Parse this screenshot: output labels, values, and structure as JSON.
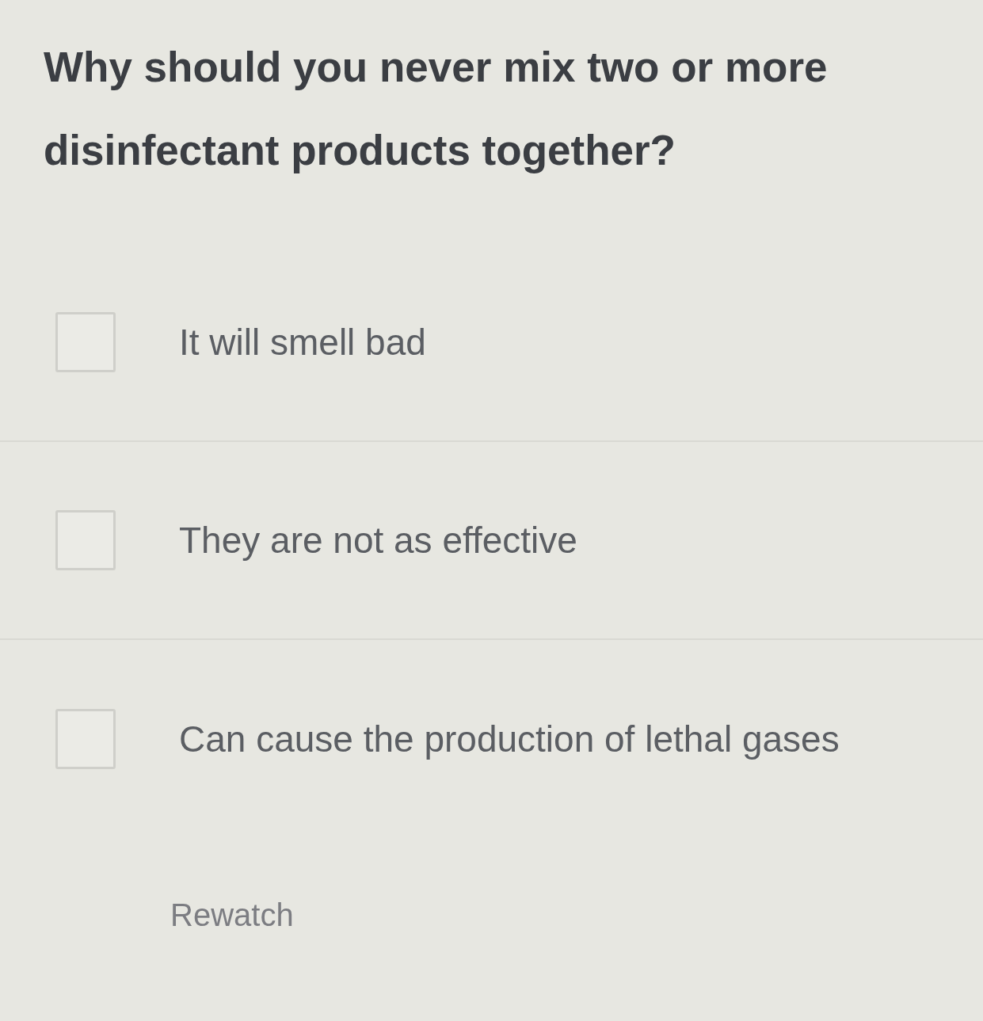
{
  "question": "Why should you never mix two or more disinfectant products together?",
  "options": [
    {
      "label": "It will smell bad",
      "checked": false
    },
    {
      "label": "They are not as effective",
      "checked": false
    },
    {
      "label": "Can cause the production of lethal gases",
      "checked": false
    }
  ],
  "rewatch_button": "Rewatch"
}
